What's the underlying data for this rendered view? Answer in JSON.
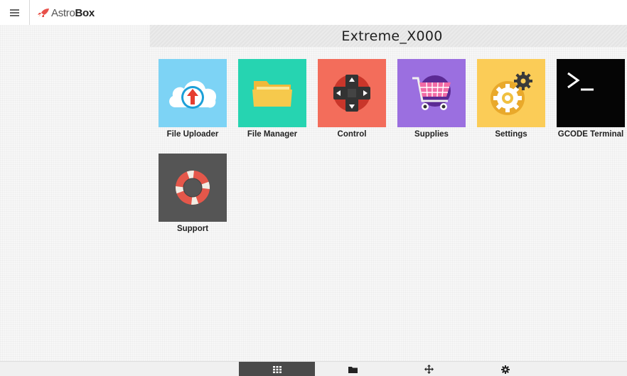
{
  "header": {
    "menu_icon": "hamburger-icon",
    "logo": {
      "icon": "rocket-icon",
      "text_light": "Astro",
      "text_bold": "Box",
      "accent_color": "#e8504a"
    }
  },
  "printer": {
    "name": "Extreme_X000"
  },
  "tiles": [
    {
      "label": "File Uploader",
      "icon": "cloud-upload-icon",
      "color": "#7dd3f5"
    },
    {
      "label": "File Manager",
      "icon": "folder-icon",
      "color": "#26d4b1"
    },
    {
      "label": "Control",
      "icon": "dpad-icon",
      "color": "#f36d5b"
    },
    {
      "label": "Supplies",
      "icon": "shopping-cart-icon",
      "color": "#9b6fe0"
    },
    {
      "label": "Settings",
      "icon": "gears-icon",
      "color": "#fbcc57"
    },
    {
      "label": "GCODE Terminal",
      "icon": "terminal-icon",
      "color": "#050505"
    },
    {
      "label": "Support",
      "icon": "lifebuoy-icon",
      "color": "#555555"
    }
  ],
  "bottom_nav": [
    {
      "icon": "grid-icon",
      "active": true
    },
    {
      "icon": "folder-icon",
      "active": false
    },
    {
      "icon": "move-icon",
      "active": false
    },
    {
      "icon": "gear-icon",
      "active": false
    }
  ]
}
